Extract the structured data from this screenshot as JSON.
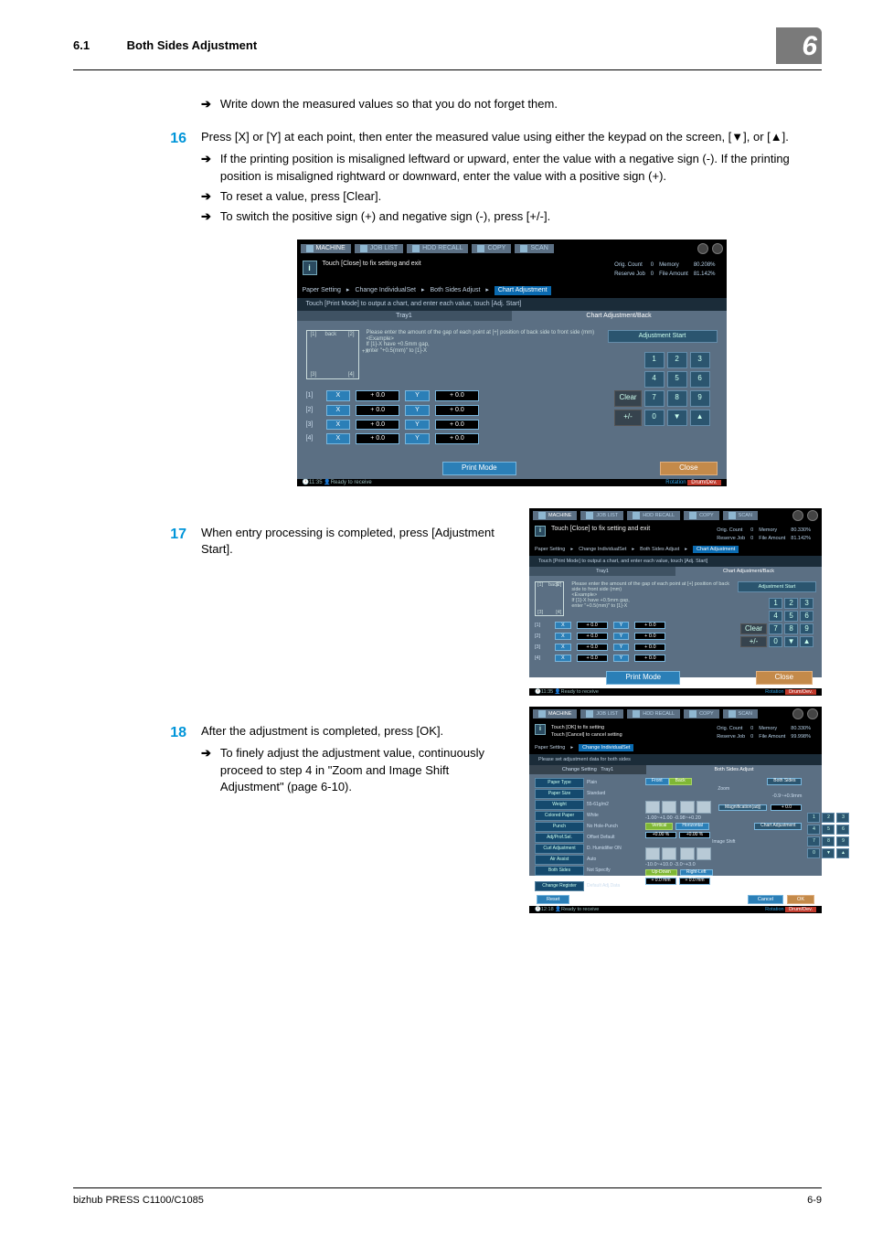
{
  "header": {
    "section_number": "6.1",
    "section_title": "Both Sides Adjustment",
    "chapter_number": "6"
  },
  "intro_bullet": "Write down the measured values so that you do not forget them.",
  "step16": {
    "num": "16",
    "text": "Press [X] or [Y] at each point, then enter the measured value using either the keypad on the screen, [▼], or [▲].",
    "bullets": [
      "If the printing position is misaligned leftward or upward, enter the value with a negative sign (-). If the printing position is misaligned rightward or downward, enter the value with a positive sign (+).",
      "To reset a value, press [Clear].",
      "To switch the positive sign (+) and negative sign (-), press [+/-]."
    ]
  },
  "step17": {
    "num": "17",
    "text": "When entry processing is completed, press [Adjustment Start]."
  },
  "step18": {
    "num": "18",
    "text": "After the adjustment is completed, press [OK].",
    "bullet": "To finely adjust the adjustment value, continuously proceed to step 4 in \"Zoom and Image Shift Adjustment\" (page 6-10)."
  },
  "panel": {
    "tabs": [
      "MACHINE",
      "JOB LIST",
      "HDD RECALL",
      "COPY",
      "SCAN"
    ],
    "info_text": "Touch [Close] to fix setting and exit",
    "info_text2_line1": "Touch [OK] to fix setting",
    "info_text2_line2": "Touch [Cancel] to cancel setting",
    "orig_count_label": "Orig. Count",
    "orig_count_val": "0",
    "reserve_job_label": "Reserve Job",
    "reserve_job_val": "0",
    "memory_label": "Memory",
    "memory_val": "80.208%",
    "file_amount_label": "File Amount",
    "file_amount_val": "81.142%",
    "memory_val2": "80.330%",
    "file_amount_val2": "81.142%",
    "memory_val3": "80.330%",
    "file_amount_val3": "99.998%",
    "crumbs": [
      "Paper Setting",
      "Change IndividualSet",
      "Both Sides Adjust",
      "Chart Adjustment"
    ],
    "crumbs3": [
      "Paper Setting",
      "Change IndividualSet"
    ],
    "hint": "Touch [Print Mode] to output a chart, and enter each value, touch [Adj. Start]",
    "hint3": "Please set adjustment data for both sides",
    "tabline": [
      "Tray1",
      "Chart Adjustment/Back"
    ],
    "change_setting_label": "Change Setting",
    "tray_label": "Tray1",
    "both_sides_adjust_title": "Both Sides Adjust",
    "diagram": {
      "back_label": "back",
      "markers": [
        "[1]",
        "[2]",
        "[3]",
        "[4]"
      ],
      "plusX": "+X",
      "text": "Please enter the amount of the gap of each point at [+] position of back side to front side (mm)\n<Example>\nIf [1]-X have +0.5mm gap,\nenter \"+0.5(mm)\" to [1]-X"
    },
    "rows": [
      {
        "idx": "[1]",
        "x": "X",
        "xv": "+ 0.0",
        "y": "Y",
        "yv": "+ 0.0"
      },
      {
        "idx": "[2]",
        "x": "X",
        "xv": "+ 0.0",
        "y": "Y",
        "yv": "+ 0.0"
      },
      {
        "idx": "[3]",
        "x": "X",
        "xv": "+ 0.0",
        "y": "Y",
        "yv": "+ 0.0"
      },
      {
        "idx": "[4]",
        "x": "X",
        "xv": "+ 0.0",
        "y": "Y",
        "yv": "+ 0.0"
      }
    ],
    "adjustment_start": "Adjustment Start",
    "keypad": [
      "1",
      "2",
      "3",
      "4",
      "5",
      "6",
      "7",
      "8",
      "9",
      "0",
      "▼",
      "▲"
    ],
    "keypad_clear": "Clear",
    "keypad_pm": "+/-",
    "print_mode": "Print Mode",
    "close": "Close",
    "status_time": "11:35",
    "status_time2": "11:35",
    "status_time3": "12:18",
    "status_text": "Ready to receive",
    "rotation": "Rotation",
    "drum": "Drum/Dev."
  },
  "panel3": {
    "left_items": [
      {
        "label": "Paper Type",
        "value": "Plain"
      },
      {
        "label": "Paper Size",
        "value": "Standard"
      },
      {
        "label": "Weight",
        "value": "55-61g/m2"
      },
      {
        "label": "Colored Paper",
        "value": "White"
      },
      {
        "label": "Punch",
        "value": "No Hole-Punch"
      },
      {
        "label": "Adj/Prof.Sel.",
        "value": "Offset Default"
      },
      {
        "label": "Curl Adjustment",
        "value": "D. Humidifier ON"
      },
      {
        "label": "Air Assist",
        "value": "Auto"
      },
      {
        "label": "Both Sides",
        "value": "Not Specify"
      },
      {
        "label": "Change Register",
        "value": "Default Adj.Data"
      }
    ],
    "front": "Front",
    "back": "Back",
    "zoom_label": "Zoom",
    "range_zoom": "-0.9~+0.9mm",
    "magnification_label": "Magnification(adj)",
    "magnification_val": "+ 0.0",
    "range_mag": "-1.00~+1.00  -0.98~+0.20",
    "chart_adjustment": "Chart Adjustment",
    "vertical": "Vertical",
    "horizontal": "Horizontal",
    "both_sides": "Both Sides",
    "vert_val": "+0.00 %",
    "horiz_val": "+0.00 %",
    "image_shift_label": "Image Shift",
    "range_shift": "-10.0~+10.0  -3.0~+3.0",
    "up_down": "Up-Down",
    "right_left": "Right-Left",
    "ud_val": "+ 0.0 mm",
    "rl_val": "+ 0.0 mm",
    "reset": "Reset",
    "cancel": "Cancel",
    "ok": "OK"
  },
  "footer": {
    "left": "bizhub PRESS C1100/C1085",
    "right": "6-9"
  }
}
